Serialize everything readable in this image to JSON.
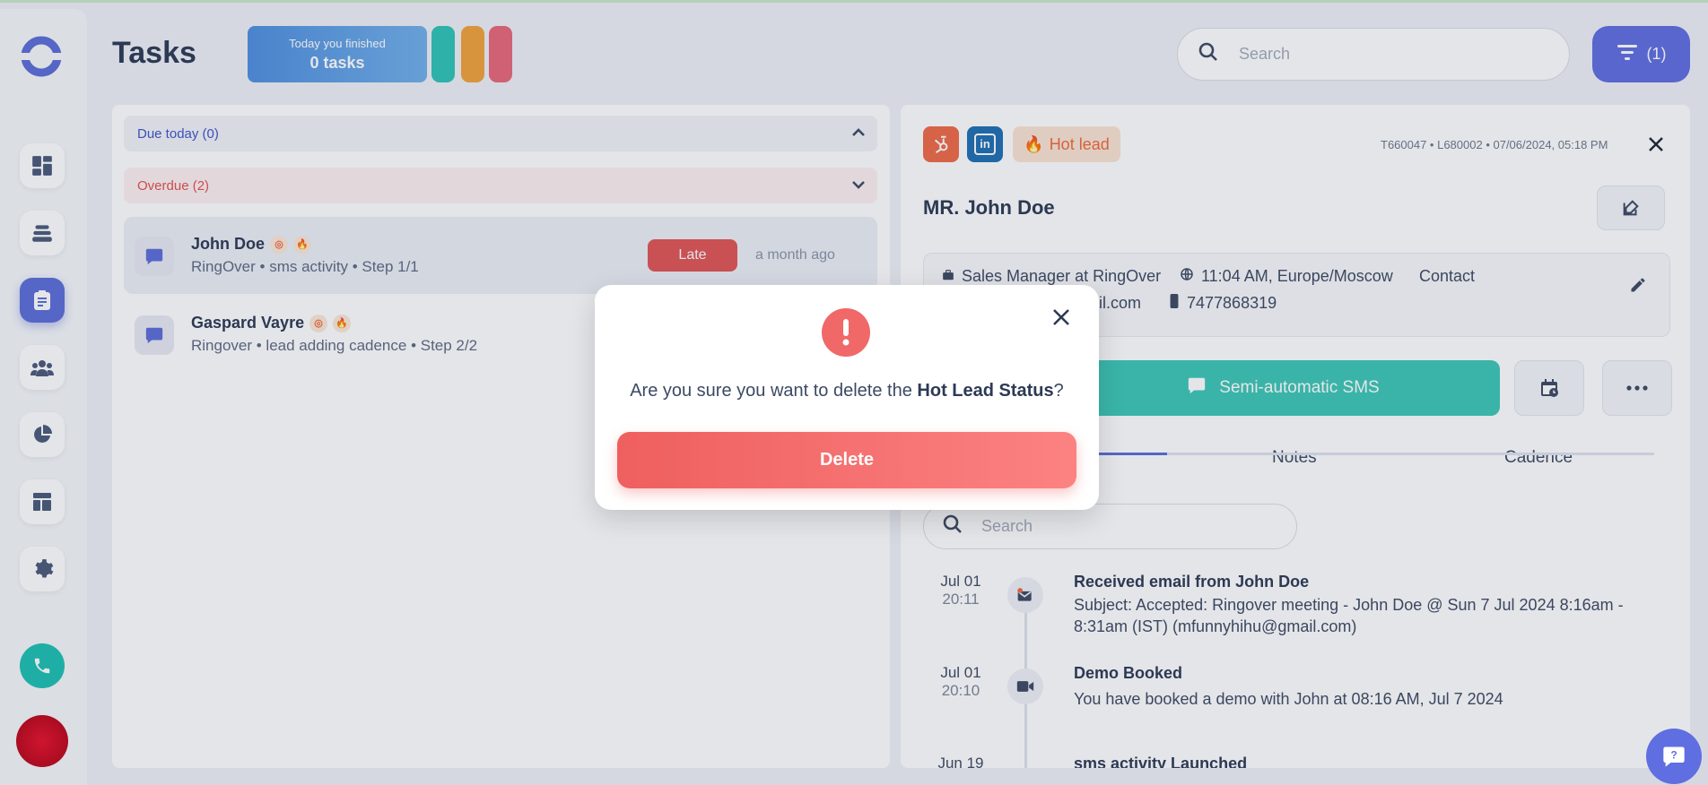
{
  "app": {
    "title": "Tasks"
  },
  "header": {
    "finished_line1": "Today you finished",
    "finished_line2": "0 tasks",
    "search_placeholder": "Search",
    "filter_label": "(1)",
    "pill_colors": [
      "#2ec4b6",
      "#f2a33a",
      "#e8677a"
    ]
  },
  "sidebar": {
    "items": [
      "dashboard-icon",
      "layers-icon",
      "tasks-icon",
      "people-icon",
      "pie-chart-icon",
      "templates-icon",
      "settings-icon"
    ],
    "active_index": 2
  },
  "tasks_panel": {
    "due_today": "Due today (0)",
    "overdue": "Overdue (2)",
    "tasks": [
      {
        "name": "John Doe",
        "subtitle": "RingOver • sms activity • Step 1/1",
        "status": "Late",
        "time": "a month ago"
      },
      {
        "name": "Gaspard Vayre",
        "subtitle": "Ringover • lead adding cadence • Step 2/2"
      }
    ]
  },
  "lead": {
    "hot_lead_label": "Hot lead",
    "meta": "T660047 • L680002 • 07/06/2024, 05:18 PM",
    "name": "MR. John Doe",
    "job": "Sales Manager at RingOver",
    "timezone": "11:04 AM, Europe/Moscow",
    "contact": "Contact",
    "email_partial": "ail.com",
    "phone": "7477868319",
    "action_label": "Semi-automatic SMS",
    "tabs": [
      "Notes",
      "Cadence"
    ],
    "search_placeholder": "Search",
    "timeline": [
      {
        "date": "Jul 01",
        "time": "20:11",
        "title": "Received email from John Doe",
        "body": "Subject: Accepted: Ringover meeting - John Doe @ Sun 7 Jul 2024 8:16am - 8:31am (IST) (mfunnyhihu@gmail.com)"
      },
      {
        "date": "Jul 01",
        "time": "20:10",
        "title": "Demo Booked",
        "body": "You have booked a demo with John at 08:16 AM, Jul 7 2024"
      },
      {
        "date": "Jun 19",
        "title": "sms activity Launched"
      }
    ]
  },
  "modal": {
    "text_before": "Are you sure you want to delete the ",
    "text_bold": "Hot Lead Status",
    "text_after": "?",
    "delete_label": "Delete"
  }
}
